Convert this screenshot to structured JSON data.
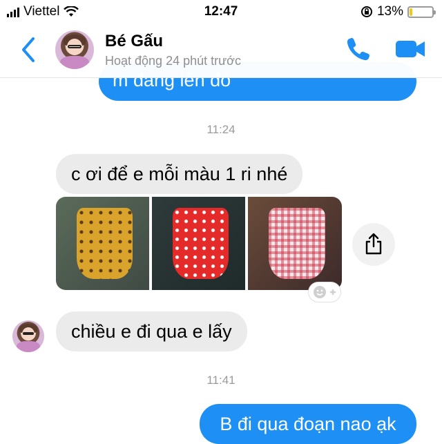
{
  "status_bar": {
    "carrier": "Viettel",
    "time": "12:47",
    "battery_percent": "13%",
    "battery_level": 0.13
  },
  "header": {
    "contact_name": "Bé Gấu",
    "presence": "Hoạt động 24 phút trước",
    "icons": [
      "back-chevron-icon",
      "phone-icon",
      "video-camera-icon"
    ]
  },
  "messages": [
    {
      "type": "outgoing",
      "text": "m đang lên đó",
      "partially_visible": true
    },
    {
      "type": "timestamp",
      "text": "11:24"
    },
    {
      "type": "incoming",
      "text": "c ơi để e mỗi màu 1 ri nhé"
    },
    {
      "type": "incoming-photos",
      "photos": [
        "yellow-dress-photo",
        "red-dress-photo",
        "pink-gingham-dress-photo"
      ]
    },
    {
      "type": "incoming",
      "text": "chiều e đi qua e lấy"
    },
    {
      "type": "timestamp",
      "text": "11:41"
    },
    {
      "type": "outgoing",
      "text": "B đi qua đoạn nao ạk"
    }
  ],
  "colors": {
    "accent": "#1d8ff5",
    "incoming_bubble": "#ebebeb",
    "battery_fill": "#f5c518"
  }
}
